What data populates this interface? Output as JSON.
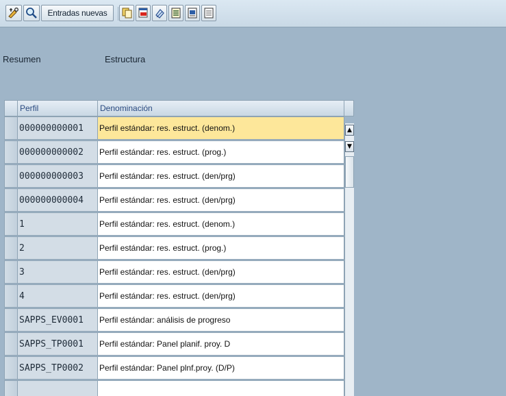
{
  "toolbar": {
    "entradas_nuevas_label": "Entradas nuevas",
    "icons": [
      "glasses-icon",
      "find-icon",
      "copy-icon",
      "delete-icon",
      "undo-icon",
      "select-all-icon",
      "select-block-icon",
      "deselect-all-icon"
    ]
  },
  "headers": {
    "resumen": "Resumen",
    "estructura": "Estructura"
  },
  "table": {
    "columns": [
      "Perfil",
      "Denominación"
    ],
    "rows": [
      {
        "perfil": "000000000001",
        "den": "Perfil estándar: res. estruct. (denom.)"
      },
      {
        "perfil": "000000000002",
        "den": "Perfil estándar: res. estruct. (prog.)"
      },
      {
        "perfil": "000000000003",
        "den": "Perfil estándar: res. estruct. (den/prg)"
      },
      {
        "perfil": "000000000004",
        "den": "Perfil estándar: res. estruct. (den/prg)"
      },
      {
        "perfil": "1",
        "den": "Perfil estándar: res. estruct. (denom.)"
      },
      {
        "perfil": "2",
        "den": "Perfil estándar: res. estruct. (prog.)"
      },
      {
        "perfil": "3",
        "den": "Perfil estándar: res. estruct. (den/prg)"
      },
      {
        "perfil": "4",
        "den": "Perfil estándar: res. estruct. (den/prg)"
      },
      {
        "perfil": "SAPPS_EV0001",
        "den": "Perfil estándar: análisis de progreso"
      },
      {
        "perfil": "SAPPS_TP0001",
        "den": "Perfil estándar: Panel planif. proy. D"
      },
      {
        "perfil": "SAPPS_TP0002",
        "den": "Perfil estándar: Panel plnf.proy. (D/P)"
      },
      {
        "perfil": "",
        "den": ""
      }
    ],
    "selected_row": 0
  },
  "colors": {
    "background": "#9fb5c8",
    "selected": "#fde79a",
    "header_text": "#2a4a80"
  }
}
